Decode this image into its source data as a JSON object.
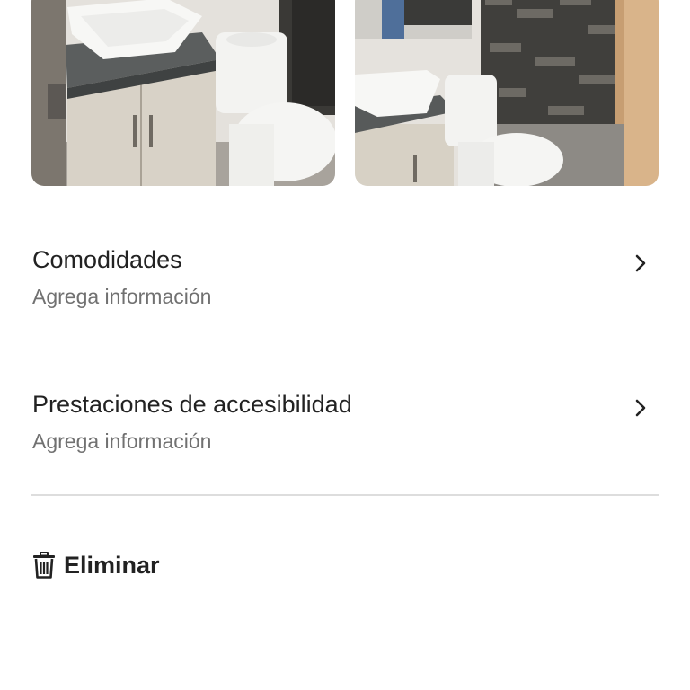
{
  "photos": [
    {
      "name": "bathroom-photo-1"
    },
    {
      "name": "bathroom-photo-2"
    }
  ],
  "sections": {
    "amenities": {
      "title": "Comodidades",
      "subtitle": "Agrega información",
      "icon": "chevron-right-icon"
    },
    "accessibility": {
      "title": "Prestaciones de accesibilidad",
      "subtitle": "Agrega información",
      "icon": "chevron-right-icon"
    }
  },
  "actions": {
    "delete_label": "Eliminar",
    "delete_icon": "trash-icon"
  },
  "colors": {
    "text_primary": "#222222",
    "text_secondary": "#717171",
    "divider": "#dddddd",
    "background": "#ffffff"
  }
}
